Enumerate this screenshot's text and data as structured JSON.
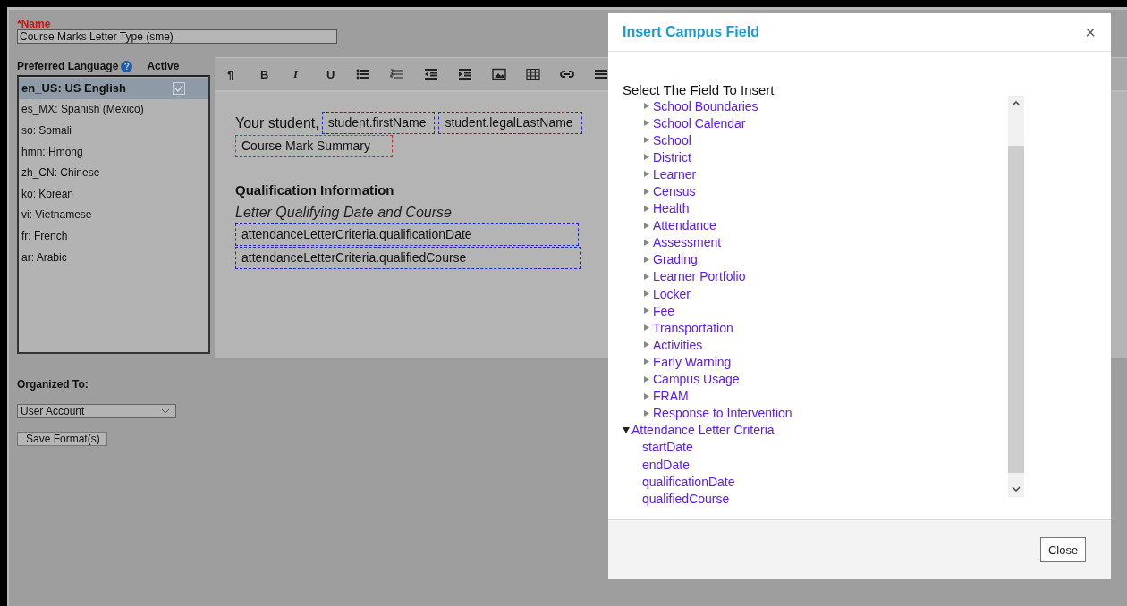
{
  "form": {
    "name_label": "*Name",
    "name_value": "Course Marks Letter Type (sme)",
    "language_header": "Preferred Language",
    "help_icon": "?",
    "active_header": "Active",
    "languages": [
      {
        "label": "en_US: US English",
        "selected": true,
        "active": true
      },
      {
        "label": "es_MX: Spanish (Mexico)",
        "selected": false,
        "active": false
      },
      {
        "label": "so: Somali",
        "selected": false,
        "active": false
      },
      {
        "label": "hmn: Hmong",
        "selected": false,
        "active": false
      },
      {
        "label": "zh_CN: Chinese",
        "selected": false,
        "active": false
      },
      {
        "label": "ko: Korean",
        "selected": false,
        "active": false
      },
      {
        "label": "vi: Vietnamese",
        "selected": false,
        "active": false
      },
      {
        "label": "fr: French",
        "selected": false,
        "active": false
      },
      {
        "label": "ar: Arabic",
        "selected": false,
        "active": false
      }
    ],
    "organized_label": "Organized To:",
    "organized_value": "User Account",
    "save_button": "Save Format(s)"
  },
  "editor": {
    "toolbar_glyphs": [
      "¶",
      "B",
      "I",
      "U"
    ],
    "content": [
      {
        "kind": "line",
        "parts": [
          {
            "kind": "text",
            "text": "Your student,"
          },
          {
            "kind": "field",
            "text": "student.firstName",
            "color": "#2323d6"
          },
          {
            "kind": "field",
            "text": "student.legalLastName",
            "color": "#2323d6"
          }
        ]
      },
      {
        "kind": "line",
        "parts": [
          {
            "kind": "field",
            "text": "Course Mark Summary",
            "color": "#e02020"
          }
        ]
      },
      {
        "kind": "heading",
        "text": "Qualification Information"
      },
      {
        "kind": "subtitle",
        "text": "Letter Qualifying Date and Course"
      },
      {
        "kind": "line",
        "parts": [
          {
            "kind": "field",
            "text": "attendanceLetterCriteria.qualificationDate",
            "color": "#2323d6"
          }
        ]
      },
      {
        "kind": "line",
        "parts": [
          {
            "kind": "field",
            "text": "attendanceLetterCriteria.qualifiedCourse",
            "color": "#2323d6"
          }
        ]
      }
    ]
  },
  "dialog": {
    "title": "Insert Campus Field",
    "close_icon": "×",
    "prompt": "Select The Field To Insert",
    "tree": [
      {
        "children": [
          {
            "label": "School Boundaries",
            "expanded": false
          },
          {
            "label": "School Calendar",
            "expanded": false
          },
          {
            "label": "School",
            "expanded": false
          },
          {
            "label": "District",
            "expanded": false
          },
          {
            "label": "Learner",
            "expanded": false
          },
          {
            "label": "Census",
            "expanded": false
          },
          {
            "label": "Health",
            "expanded": false
          },
          {
            "label": "Attendance",
            "expanded": false
          },
          {
            "label": "Assessment",
            "expanded": false
          },
          {
            "label": "Grading",
            "expanded": false
          },
          {
            "label": "Learner Portfolio",
            "expanded": false
          },
          {
            "label": "Locker",
            "expanded": false
          },
          {
            "label": "Fee",
            "expanded": false
          },
          {
            "label": "Transportation",
            "expanded": false
          },
          {
            "label": "Activities",
            "expanded": false
          },
          {
            "label": "Early Warning",
            "expanded": false
          },
          {
            "label": "Campus Usage",
            "expanded": false
          },
          {
            "label": "FRAM",
            "expanded": false
          },
          {
            "label": "Response to Intervention",
            "expanded": false
          }
        ]
      },
      {
        "label": "Attendance Letter Criteria",
        "expanded": true,
        "children": [
          {
            "label": "startDate"
          },
          {
            "label": "endDate"
          },
          {
            "label": "qualificationDate"
          },
          {
            "label": "qualifiedCourse"
          }
        ]
      }
    ],
    "close_button": "Close"
  }
}
